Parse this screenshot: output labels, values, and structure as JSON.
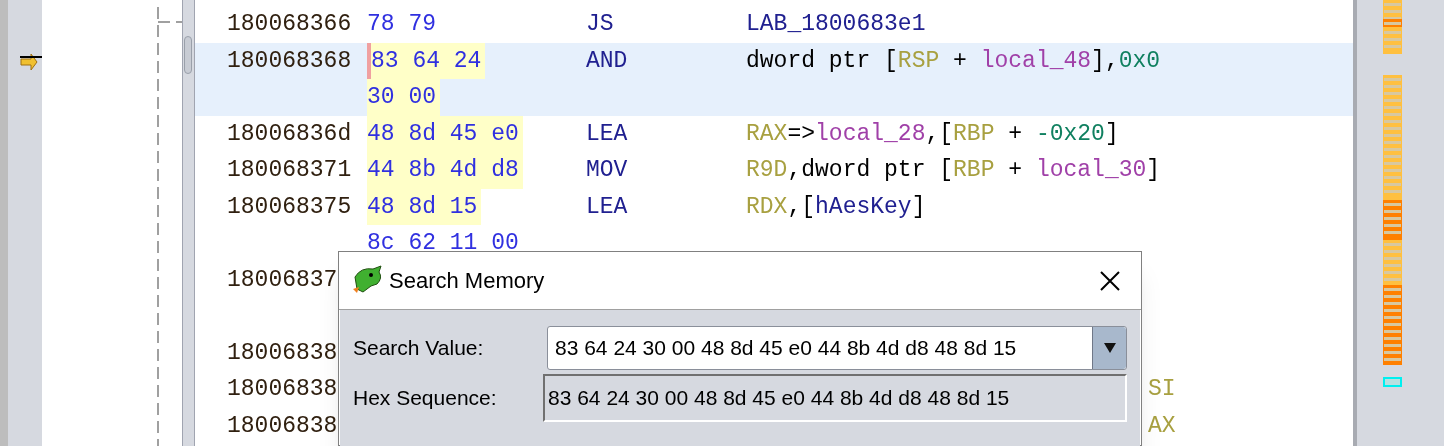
{
  "listing": {
    "rows": [
      {
        "address": "180068366",
        "bytes": [
          {
            "text": "78 79",
            "highlighted": false
          }
        ],
        "mnemonic": "JS",
        "operands": [
          {
            "kind": "label",
            "text": "LAB_1800683e1"
          }
        ],
        "selected": false,
        "covered": false
      },
      {
        "address": "180068368",
        "bytes": [
          {
            "text": "83 64 24",
            "highlighted": true
          },
          {
            "text": "30 00",
            "highlighted": true
          }
        ],
        "mnemonic": "AND",
        "operands": [
          {
            "kind": "plain",
            "text": "dword ptr ["
          },
          {
            "kind": "register",
            "text": "RSP"
          },
          {
            "kind": "plain",
            "text": " + "
          },
          {
            "kind": "local",
            "text": "local_48"
          },
          {
            "kind": "plain",
            "text": "],"
          },
          {
            "kind": "scalar",
            "text": "0x0"
          }
        ],
        "selected": true,
        "covered": false
      },
      {
        "address": "18006836d",
        "bytes": [
          {
            "text": "48 8d 45 e0",
            "highlighted": true
          }
        ],
        "mnemonic": "LEA",
        "operands": [
          {
            "kind": "register",
            "text": "RAX"
          },
          {
            "kind": "plain",
            "text": "=>"
          },
          {
            "kind": "local",
            "text": "local_28"
          },
          {
            "kind": "plain",
            "text": ",["
          },
          {
            "kind": "register",
            "text": "RBP"
          },
          {
            "kind": "plain",
            "text": " + "
          },
          {
            "kind": "scalar",
            "text": "-0x20"
          },
          {
            "kind": "plain",
            "text": "]"
          }
        ],
        "selected": false,
        "covered": false
      },
      {
        "address": "180068371",
        "bytes": [
          {
            "text": "44 8b 4d d8",
            "highlighted": true
          }
        ],
        "mnemonic": "MOV",
        "operands": [
          {
            "kind": "register",
            "text": "R9D"
          },
          {
            "kind": "plain",
            "text": ",dword ptr ["
          },
          {
            "kind": "register",
            "text": "RBP"
          },
          {
            "kind": "plain",
            "text": " + "
          },
          {
            "kind": "local",
            "text": "local_30"
          },
          {
            "kind": "plain",
            "text": "]"
          }
        ],
        "selected": false,
        "covered": false
      },
      {
        "address": "180068375",
        "bytes": [
          {
            "text": "48 8d 15",
            "highlighted": true
          },
          {
            "text": "8c 62 11 00",
            "highlighted": false
          }
        ],
        "mnemonic": "LEA",
        "operands": [
          {
            "kind": "register",
            "text": "RDX"
          },
          {
            "kind": "plain",
            "text": ",["
          },
          {
            "kind": "label",
            "text": "hAesKey"
          },
          {
            "kind": "plain",
            "text": "]"
          }
        ],
        "selected": false,
        "covered": false
      },
      {
        "address": "18006837",
        "bytes": [],
        "operands": [],
        "selected": false,
        "covered": true
      },
      {
        "address": "18006838",
        "bytes": [],
        "operands": [],
        "selected": false,
        "covered": true
      },
      {
        "address": "18006838",
        "bytes": [],
        "operands": [
          {
            "kind": "register",
            "text": "SI"
          }
        ],
        "selected": false,
        "covered": true
      },
      {
        "address": "18006838",
        "bytes": [],
        "operands": [
          {
            "kind": "register",
            "text": "AX"
          }
        ],
        "selected": false,
        "covered": true
      }
    ]
  },
  "dialog": {
    "title": "Search Memory",
    "fields": [
      {
        "kind": "combo",
        "label": "Search Value:",
        "value": "83 64 24 30 00 48 8d 45 e0 44 8b 4d d8 48 8d 15"
      },
      {
        "kind": "readonly",
        "label": "Hex Sequence:",
        "value": "83 64 24 30 00 48 8d 45 e0 44 8b 4d d8 48 8d 15"
      }
    ]
  }
}
